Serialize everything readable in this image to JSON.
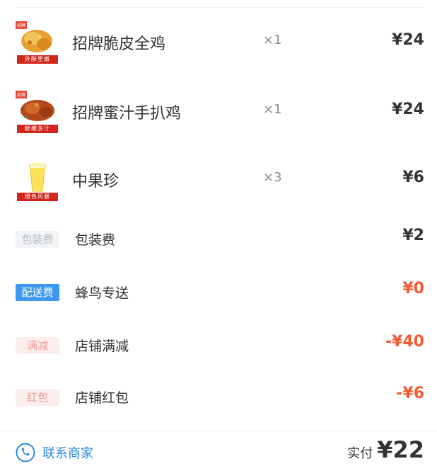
{
  "order_items": [
    {
      "name": "招牌脆皮全鸡",
      "qty": "×1",
      "price": "¥24",
      "thumb_caption": "外酥里嫩",
      "thumb_tag": "招牌"
    },
    {
      "name": "招牌蜜汁手扒鸡",
      "qty": "×1",
      "price": "¥24",
      "thumb_caption": "鲜嫩多汁",
      "thumb_tag": "招牌"
    },
    {
      "name": "中果珍",
      "qty": "×3",
      "price": "¥6",
      "thumb_caption": "橙色风暴",
      "thumb_tag": ""
    }
  ],
  "fees": [
    {
      "badge": "包装费",
      "label": "包装费",
      "value": "¥2"
    },
    {
      "badge": "配送费",
      "label": "蜂鸟专送",
      "value": "¥0"
    },
    {
      "badge": "满减",
      "label": "店铺满减",
      "value": "-¥40"
    },
    {
      "badge": "红包",
      "label": "店铺红包",
      "value": "-¥6"
    }
  ],
  "footer": {
    "contact_label": "联系商家",
    "paid_label": "实付",
    "paid_value": "¥22"
  },
  "colors": {
    "accent_blue": "#2a8ae0",
    "price_red": "#f35a34",
    "ribbon_red": "#d2261d"
  }
}
